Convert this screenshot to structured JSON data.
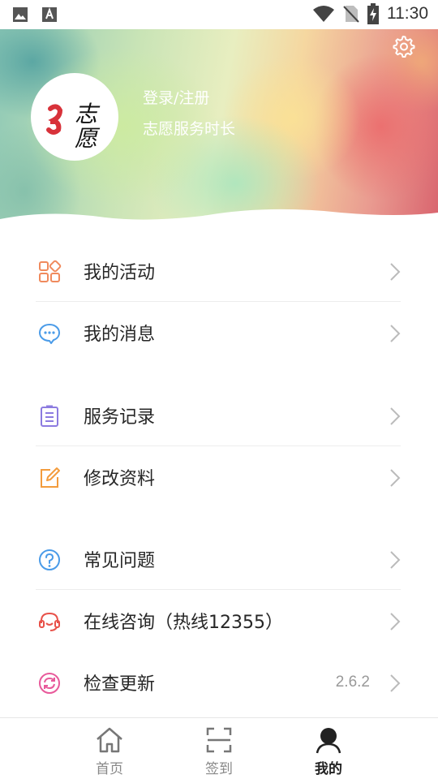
{
  "status_bar": {
    "time": "11:30"
  },
  "header": {
    "login_label": "登录/注册",
    "service_hours_label": "志愿服务时长",
    "avatar_logo_text": "志愿"
  },
  "menu": {
    "groups": [
      {
        "items": [
          {
            "label": "我的活动",
            "icon": "grid-apps-icon",
            "color": "#f08a5d"
          },
          {
            "label": "我的消息",
            "icon": "chat-bubble-icon",
            "color": "#4a9be8"
          }
        ]
      },
      {
        "items": [
          {
            "label": "服务记录",
            "icon": "clipboard-list-icon",
            "color": "#8c7be0"
          },
          {
            "label": "修改资料",
            "icon": "edit-square-icon",
            "color": "#f39c3d"
          }
        ]
      },
      {
        "items": [
          {
            "label": "常见问题",
            "icon": "question-circle-icon",
            "color": "#4a9be8"
          },
          {
            "label": "在线咨询（热线12355）",
            "icon": "headset-icon",
            "color": "#e8524a"
          },
          {
            "label": "检查更新",
            "icon": "refresh-circle-icon",
            "color": "#e85a9b",
            "value": "2.6.2"
          }
        ]
      }
    ]
  },
  "tabbar": {
    "tabs": [
      {
        "label": "首页",
        "icon": "home-icon"
      },
      {
        "label": "签到",
        "icon": "scan-icon"
      },
      {
        "label": "我的",
        "icon": "user-icon",
        "active": true
      }
    ]
  }
}
